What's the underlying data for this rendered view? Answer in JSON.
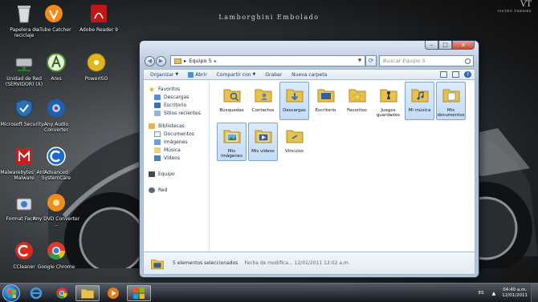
{
  "wallpaper": {
    "title": "Lamborghini Embolado",
    "logo": "VT",
    "logo_sub": "VISTEO THEMES"
  },
  "desktop_icons": [
    {
      "label": "Papelera de reciclaje",
      "icon": "recycle-bin-icon"
    },
    {
      "label": "aTube Catcher",
      "icon": "atube-catcher-icon"
    },
    {
      "label": "Adobe Reader 9",
      "icon": "adobe-reader-icon"
    },
    {
      "label": "Unidad de Red (SERVIDOR) (X)",
      "icon": "network-drive-icon"
    },
    {
      "label": "Ares",
      "icon": "ares-icon"
    },
    {
      "label": "PowerISO",
      "icon": "poweriso-icon"
    },
    {
      "label": "Microsoft Security...",
      "icon": "security-icon"
    },
    {
      "label": "Any Audio Converter",
      "icon": "audio-converter-icon"
    },
    {
      "label": "Malwarebytes' Anti-Malware",
      "icon": "malwarebytes-icon"
    },
    {
      "label": "Advanced SystemCare",
      "icon": "systemcare-icon"
    },
    {
      "label": "Format Factory",
      "icon": "format-factory-icon"
    },
    {
      "label": "Any DVD Converter ...",
      "icon": "dvd-converter-icon"
    },
    {
      "label": "CCleaner",
      "icon": "ccleaner-icon"
    },
    {
      "label": "Google Chrome",
      "icon": "chrome-icon"
    }
  ],
  "window": {
    "address": {
      "crumb": "Equipo 5",
      "chevron": "▸"
    },
    "search_placeholder": "Buscar Equipo 5",
    "controls": {
      "minimize": "–",
      "maximize": "□",
      "close": "x"
    },
    "toolbar": {
      "organize": "Organizar",
      "open": "Abrir",
      "share": "Compartir con",
      "burn": "Grabar",
      "new_folder": "Nueva carpeta"
    },
    "nav_pane": {
      "favorites": "Favoritos",
      "favorites_items": [
        "Descargas",
        "Escritorio",
        "Sitios recientes"
      ],
      "libraries": "Bibliotecas",
      "libraries_items": [
        "Documentos",
        "Imágenes",
        "Música",
        "Vídeos"
      ],
      "computer": "Equipo",
      "network": "Red"
    },
    "items": [
      {
        "label": "Búsquedas",
        "selected": false,
        "icon": "search-folder-icon"
      },
      {
        "label": "Contactos",
        "selected": false,
        "icon": "contacts-folder-icon"
      },
      {
        "label": "Descargas",
        "selected": true,
        "icon": "downloads-folder-icon"
      },
      {
        "label": "Escritorio",
        "selected": false,
        "icon": "desktop-folder-icon"
      },
      {
        "label": "Favoritos",
        "selected": false,
        "icon": "favorites-folder-icon"
      },
      {
        "label": "Juegos guardados",
        "selected": false,
        "icon": "saved-games-folder-icon"
      },
      {
        "label": "Mi música",
        "selected": true,
        "icon": "music-folder-icon"
      },
      {
        "label": "Mis documentos",
        "selected": true,
        "icon": "documents-folder-icon"
      },
      {
        "label": "Mis imágenes",
        "selected": true,
        "icon": "pictures-folder-icon"
      },
      {
        "label": "Mis vídeos",
        "selected": true,
        "icon": "videos-folder-icon"
      },
      {
        "label": "Vínculos",
        "selected": false,
        "icon": "links-folder-icon"
      }
    ],
    "details": {
      "selection": "5 elementos seleccionados",
      "meta": "Fecha de modifica... 12/01/2011 12:02 a.m."
    }
  },
  "taskbar": {
    "language": "ES",
    "tray_arrow": "▲",
    "time": "04:40 a.m.",
    "date": "12/01/2011",
    "pinned": [
      "ie-icon",
      "chrome-icon",
      "explorer-icon",
      "media-player-icon",
      "windows-icon"
    ]
  },
  "colors": {
    "selection": "#c4dcf6",
    "folder": "#e8c24f",
    "window_frame": "#aabdd3"
  }
}
